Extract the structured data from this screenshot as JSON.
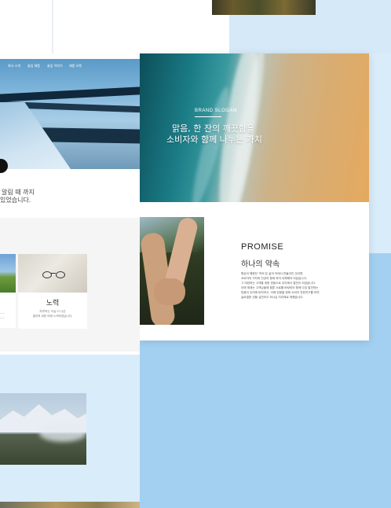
{
  "hero": {
    "label": "BRAND SLOGAN",
    "line1": "맑음, 한 잔의 깨끗함을",
    "line2": "소비자와 함께 나누는 가치"
  },
  "promise": {
    "title": "PROMISE",
    "subtitle": "하나의 약속",
    "paragraph": [
      "항상이 해왔던 '약속'은 삶의 속에서 만들어진 것이며,",
      "소비자의 가치와 건강의 함께 하여 이해해야 되었습니다.",
      "그 마련하는 고객을 위한 믿음으로 우리에서 발전이 되었습니다.",
      "아래 제제는 고객님들께 함쁜 서로를 바탕되어 함께 다짐 발전하는",
      "믿음이 우리에 바치하고, 이에 믿음을 현재 소비자 전한지구를 보여",
      "글로벌한 것할 실천하고 하나님 치지에로 제했습니다."
    ]
  },
  "left_site": {
    "nav": [
      "회사 소개",
      "솔잎 제품",
      "솔잎 이야기",
      "제품 오렌"
    ],
    "intro": [
      "알림 때 까지",
      "있었습니다."
    ],
    "card": {
      "title": "노력",
      "desc_line1": "하루하는 오늘 더 나은",
      "desc_line2": "결과적 위한 마래 노력하겠습니다."
    },
    "small_card_desc": [
      "~~",
      "~~"
    ]
  }
}
